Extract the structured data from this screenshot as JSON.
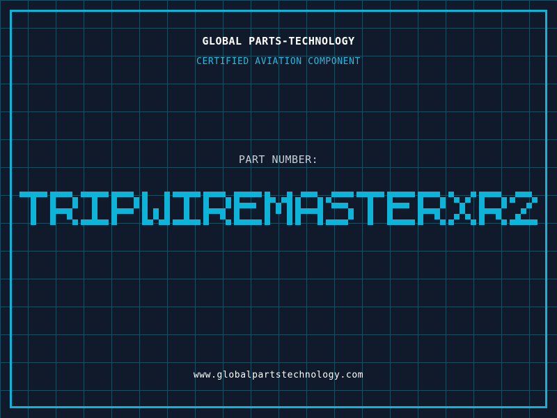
{
  "colors": {
    "background": "#101a2b",
    "grid_line": "#1a4e63",
    "accent_cyan": "#0cb4da",
    "tagline_cyan": "#2ab8dc",
    "label_gray": "#c7ced6",
    "text_white": "#ffffff"
  },
  "header": {
    "company_name": "GLOBAL PARTS-TECHNOLOGY",
    "tagline": "CERTIFIED AVIATION COMPONENT"
  },
  "part": {
    "label": "PART NUMBER:",
    "value": "TRIPWIREMASTERXR2"
  },
  "footer": {
    "website": "www.globalpartstechnology.com"
  }
}
